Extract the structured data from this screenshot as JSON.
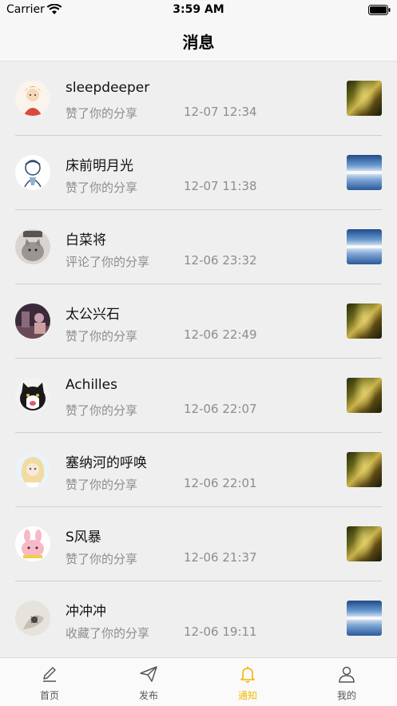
{
  "status_bar": {
    "carrier": "Carrier",
    "time": "3:59 AM"
  },
  "nav": {
    "title": "消息"
  },
  "messages": [
    {
      "name": "sleepdeeper",
      "action": "赞了你的分享",
      "time": "12-07 12:34",
      "avatar_icon": "avatar-illustration-icon",
      "thumb": "forest-photo-icon"
    },
    {
      "name": "床前明月光",
      "action": "赞了你的分享",
      "time": "12-07 11:38",
      "avatar_icon": "avatar-illustration-icon",
      "thumb": "sky-photo-icon"
    },
    {
      "name": "白菜将",
      "action": "评论了你的分享",
      "time": "12-06 23:32",
      "avatar_icon": "avatar-cat-icon",
      "thumb": "sky-photo-icon"
    },
    {
      "name": "太公兴石",
      "action": "赞了你的分享",
      "time": "12-06 22:49",
      "avatar_icon": "avatar-photo-icon",
      "thumb": "forest-photo-icon"
    },
    {
      "name": "Achilles",
      "action": "赞了你的分享",
      "time": "12-06 22:07",
      "avatar_icon": "avatar-cat-icon",
      "thumb": "forest-photo-icon"
    },
    {
      "name": "塞纳河的呼唤",
      "action": "赞了你的分享",
      "time": "12-06 22:01",
      "avatar_icon": "avatar-illustration-icon",
      "thumb": "forest-photo-icon"
    },
    {
      "name": "S风暴",
      "action": "赞了你的分享",
      "time": "12-06 21:37",
      "avatar_icon": "avatar-illustration-icon",
      "thumb": "forest-photo-icon"
    },
    {
      "name": "冲冲冲",
      "action": "收藏了你的分享",
      "time": "12-06 19:11",
      "avatar_icon": "avatar-photo-icon",
      "thumb": "sky-photo-icon"
    }
  ],
  "tabs": [
    {
      "label": "首页",
      "icon": "pencil-icon"
    },
    {
      "label": "发布",
      "icon": "paper-plane-icon"
    },
    {
      "label": "通知",
      "icon": "bell-icon",
      "active": true
    },
    {
      "label": "我的",
      "icon": "person-icon"
    }
  ],
  "colors": {
    "accent": "#f5b700",
    "secondary_text": "#8d8d8d",
    "background": "#efefef"
  }
}
